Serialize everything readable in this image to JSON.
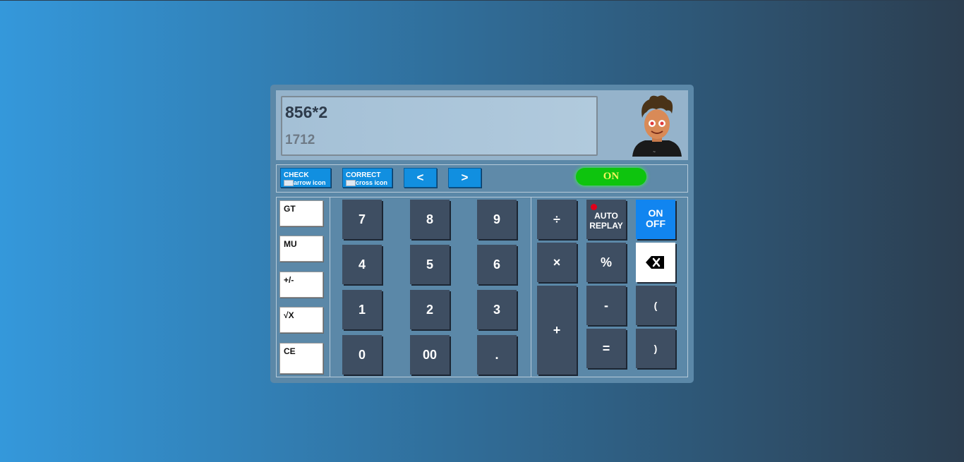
{
  "display": {
    "expression": "856*2",
    "result": "1712"
  },
  "toolbar": {
    "check_title": "CHECK",
    "check_sub": "arrow icon",
    "correct_title": "CORRECT",
    "correct_sub": "cross icon",
    "prev_label": "<",
    "next_label": ">",
    "power_status": "ON"
  },
  "memory_keys": [
    "GT",
    "MU",
    "+/-",
    "√X",
    "CE"
  ],
  "digits": [
    "7",
    "8",
    "9",
    "4",
    "5",
    "6",
    "1",
    "2",
    "3",
    "0",
    "00",
    "."
  ],
  "operators": {
    "divide": "÷",
    "multiply": "×",
    "plus": "+",
    "percent": "%",
    "minus": "-",
    "equals": "=",
    "open_paren": "(",
    "close_paren": ")",
    "auto_replay_line1": "AUTO",
    "auto_replay_line2": "REPLAY",
    "on_label": "ON",
    "off_label": "OFF"
  },
  "icons": {
    "avatar": "cartoon-avatar",
    "backspace": "backspace-icon",
    "indicator": "red-dot"
  },
  "colors": {
    "accent": "#118fe0",
    "key": "#3e4e62",
    "power": "#0ec40e"
  }
}
